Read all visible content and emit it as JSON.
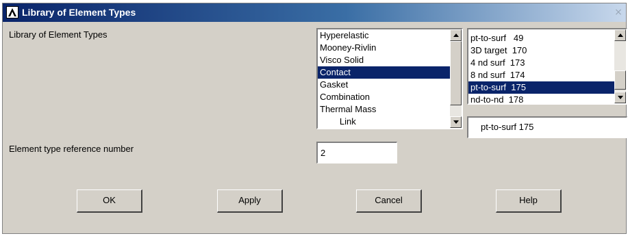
{
  "window": {
    "title": "Library of Element Types",
    "close_glyph": "×"
  },
  "labels": {
    "library": "Library of Element Types",
    "ref_number": "Element type reference number"
  },
  "category_list": {
    "items": [
      "Hyperelastic",
      "Mooney-Rivlin",
      "Visco Solid",
      "Contact",
      "Gasket",
      "Combination",
      "Thermal Mass",
      "        Link"
    ],
    "selected_index": 3
  },
  "element_list": {
    "items": [
      "pt-to-surf   49",
      "3D target  170",
      "4 nd surf  173",
      "8 nd surf  174",
      "pt-to-surf  175",
      "nd-to-nd  178"
    ],
    "selected_index": 4
  },
  "selected_element": "pt-to-surf  175",
  "ref_number_value": "2",
  "buttons": {
    "ok": "OK",
    "apply": "Apply",
    "cancel": "Cancel",
    "help": "Help"
  },
  "colors": {
    "selection": "#0a246a",
    "dialog_bg": "#d4d0c8"
  }
}
